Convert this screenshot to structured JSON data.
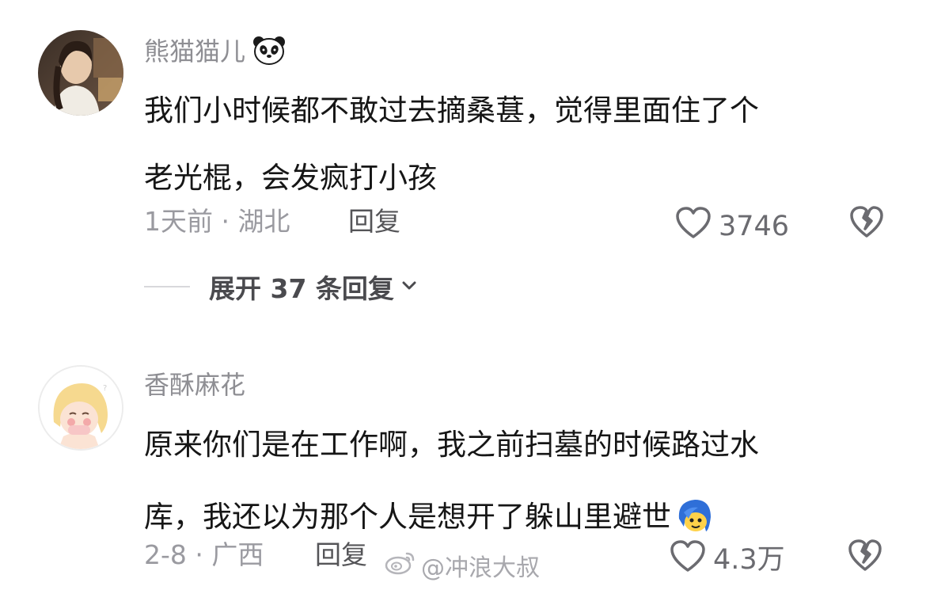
{
  "comments": [
    {
      "username": "熊猫猫儿",
      "emoji": "panda-emoji",
      "text_lines": [
        "我们小时候都不敢过去摘桑葚，觉得里面住了个",
        "老光棍，会发疯打小孩"
      ],
      "time_location": "1天前 · 湖北",
      "reply_label": "回复",
      "likes": "3746",
      "expand_replies": "展开 37 条回复"
    },
    {
      "username": "香酥麻花",
      "text_lines": [
        "原来你们是在工作啊，我之前扫墓的时候路过水",
        "库，我还以为那个人是想开了躲山里避世"
      ],
      "inline_emoji": "blue-hair-face-emoji",
      "time_location": "2-8 · 广西",
      "reply_label": "回复",
      "likes": "4.3万"
    }
  ],
  "watermark": {
    "text": "@冲浪大叔",
    "icon": "weibo-icon"
  },
  "colors": {
    "text_primary": "#161616",
    "text_secondary": "#8e8e93",
    "icon_gray": "#6b6b70"
  }
}
